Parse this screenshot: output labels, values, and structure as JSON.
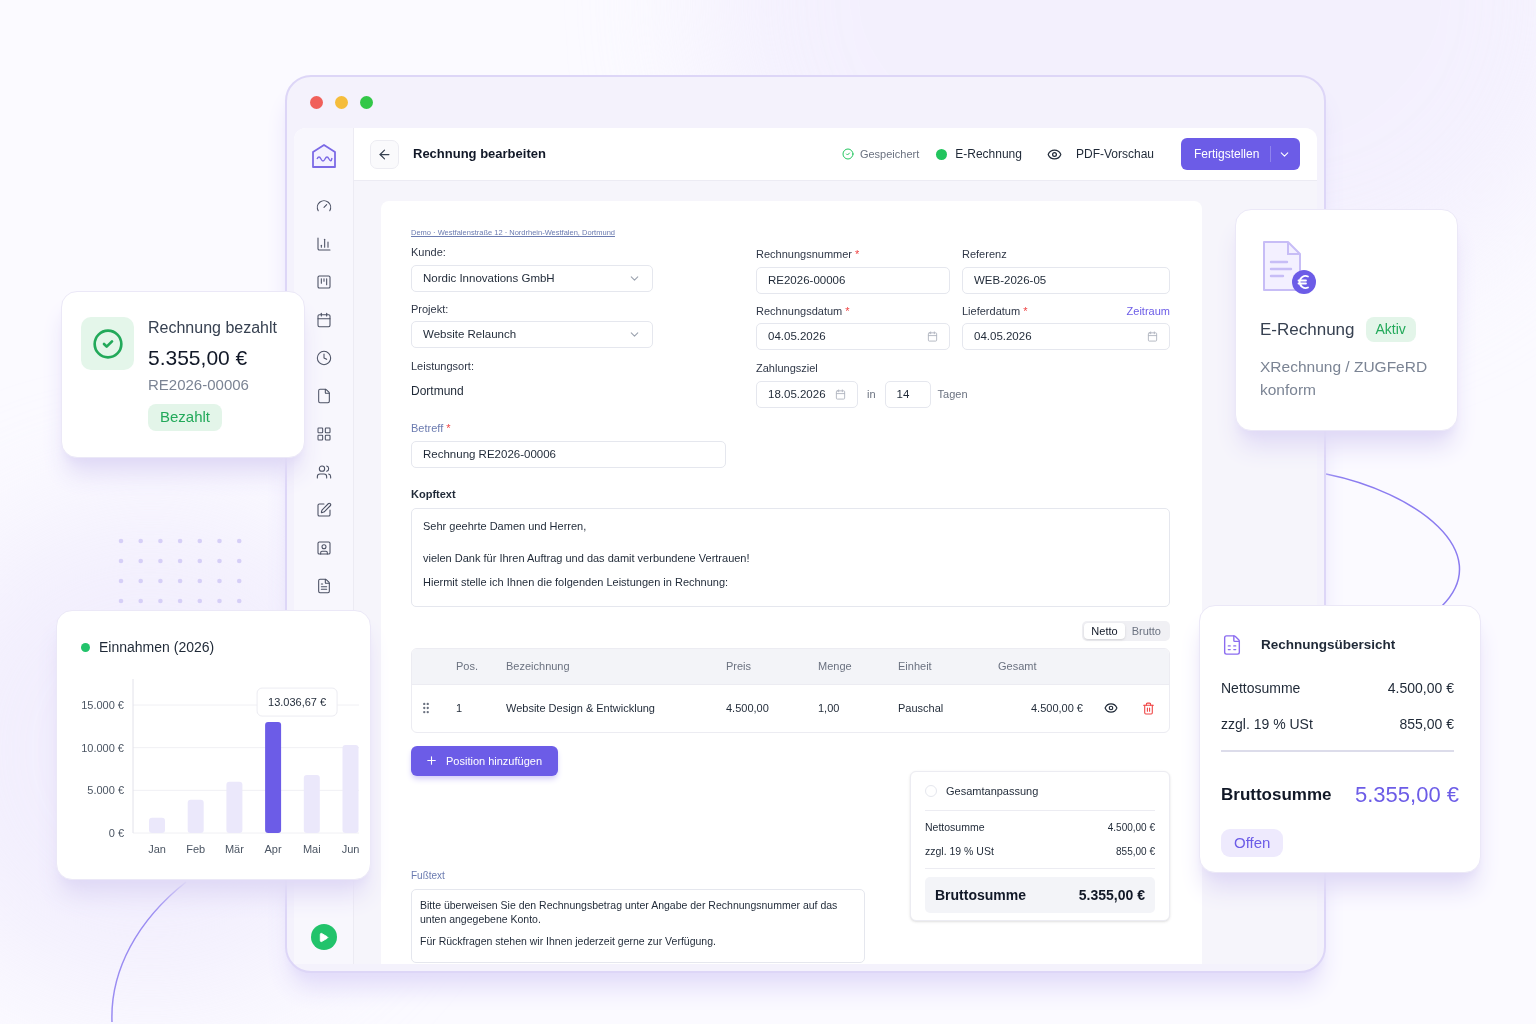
{
  "window": {
    "title": "Rechnung bearbeiten"
  },
  "header": {
    "saved": "Gespeichert",
    "e_invoice": "E-Rechnung",
    "preview": "PDF-Vorschau",
    "finish_button": "Fertigstellen"
  },
  "form": {
    "address": "Demo · Westfalenstraße 12 · Nordrhein-Westfalen, Dortmund",
    "customer": {
      "label": "Kunde:",
      "value": "Nordic Innovations GmbH"
    },
    "project": {
      "label": "Projekt:",
      "value": "Website Relaunch"
    },
    "place": {
      "label": "Leistungsort:",
      "value": "Dortmund"
    },
    "subject": {
      "label": "Betreff",
      "mark": "*",
      "value": "Rechnung RE2026-00006"
    },
    "invoice_number": {
      "label": "Rechnungsnummer",
      "mark": "*",
      "value": "RE2026-00006"
    },
    "reference": {
      "label": "Referenz",
      "value": "WEB-2026-05"
    },
    "invoice_date": {
      "label": "Rechnungsdatum",
      "mark": "*",
      "value": "04.05.2026"
    },
    "delivery_date": {
      "label": "Lieferdatum",
      "mark": "*",
      "value": "04.05.2026",
      "link": "Zeitraum"
    },
    "payment_term": {
      "label": "Zahlungsziel",
      "date": "18.05.2026",
      "in": "in",
      "days": "14",
      "unit": "Tagen"
    },
    "header_text": {
      "label": "Kopftext",
      "paragraphs": [
        [
          "Sehr geehrte Damen und Herren,"
        ],
        [
          "vielen Dank für Ihren Auftrag und das damit verbundene Vertrauen!",
          "Hiermit stelle ich Ihnen die folgenden Leistungen in Rechnung:"
        ]
      ]
    },
    "price_mode": [
      {
        "label": "Netto",
        "selected": true
      },
      {
        "label": "Brutto",
        "selected": false
      }
    ],
    "table": {
      "columns": [
        "Pos.",
        "Bezeichnung",
        "Preis",
        "Menge",
        "Einheit",
        "Gesamt"
      ],
      "rows": [
        {
          "cells": [
            "1",
            "Website Design & Entwicklung",
            "4.500,00",
            "1,00",
            "Pauschal",
            "4.500,00 €"
          ]
        }
      ]
    },
    "add_button": "Position hinzufügen",
    "totals": {
      "adjustment": {
        "label": "Gesamtanpassung",
        "checked": false
      },
      "rows": [
        {
          "label": "Nettosumme",
          "value": "4.500,00 €"
        },
        {
          "label": "zzgl. 19 % USt",
          "value": "855,00 €"
        }
      ],
      "gross": {
        "label": "Bruttosumme",
        "value": "5.355,00 €"
      }
    },
    "footer_text": {
      "label": "Fußtext",
      "paragraphs": [
        [
          "Bitte überweisen Sie den Rechnungsbetrag unter Angabe der Rechnungsnummer auf das unten angegebene Konto."
        ],
        [
          "Für Rückfragen stehen wir Ihnen jederzeit gerne zur Verfügung."
        ]
      ]
    }
  },
  "paid_card": {
    "title": "Rechnung bezahlt",
    "amount": "5.355,00 €",
    "number": "RE2026-00006",
    "badge": "Bezahlt"
  },
  "revenue_card": {
    "title": "Einnahmen (2026)",
    "chart_data": {
      "type": "bar",
      "categories": [
        "Jan",
        "Feb",
        "Mär",
        "Apr",
        "Mai",
        "Jun"
      ],
      "values": [
        1800,
        3900,
        6000,
        13000,
        6800,
        10300
      ],
      "ylim": [
        0,
        15000
      ],
      "yticks": [
        {
          "value": 0,
          "label": "0 €"
        },
        {
          "value": 5000,
          "label": "5.000 €"
        },
        {
          "value": 10000,
          "label": "10.000 €"
        },
        {
          "value": 15000,
          "label": "15.000 €"
        }
      ],
      "annotations": [
        {
          "x": "Apr",
          "y": 13000,
          "text": "13.036,67 €"
        }
      ]
    }
  },
  "e_invoice_card": {
    "title": "E-Rechnung",
    "badge": "Aktiv",
    "description": "XRechnung / ZUGFeRD konform"
  },
  "overview_card": {
    "title": "Rechnungsübersicht",
    "rows": [
      {
        "label": "Nettosumme",
        "value": "4.500,00 €"
      },
      {
        "label": "zzgl. 19 % USt",
        "value": "855,00 €"
      }
    ],
    "gross": {
      "label": "Bruttosumme",
      "value": "5.355,00 €"
    },
    "badge": "Offen"
  }
}
